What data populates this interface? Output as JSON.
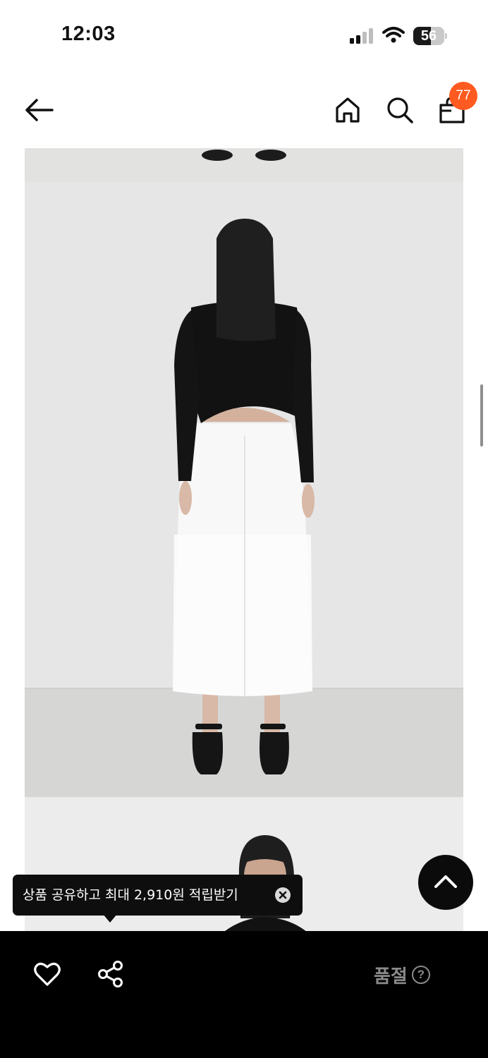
{
  "status_bar": {
    "time": "12:03",
    "battery_level": "56",
    "battery_fraction": 0.56
  },
  "nav": {
    "back_icon": "arrow-left-icon",
    "home_icon": "home-icon",
    "search_icon": "search-icon",
    "bag_icon": "shopping-bag-icon",
    "cart_count": "77",
    "badge_color": "#ff5a1f"
  },
  "tooltip": {
    "text": "상품 공유하고 최대 2,910원 적립받기",
    "close_icon": "close-icon"
  },
  "bottom_bar": {
    "wishlist_icon": "heart-icon",
    "share_icon": "share-icon",
    "status_label": "품절",
    "help_icon": "question-circle-icon"
  },
  "scroll_top_icon": "chevron-up-icon"
}
